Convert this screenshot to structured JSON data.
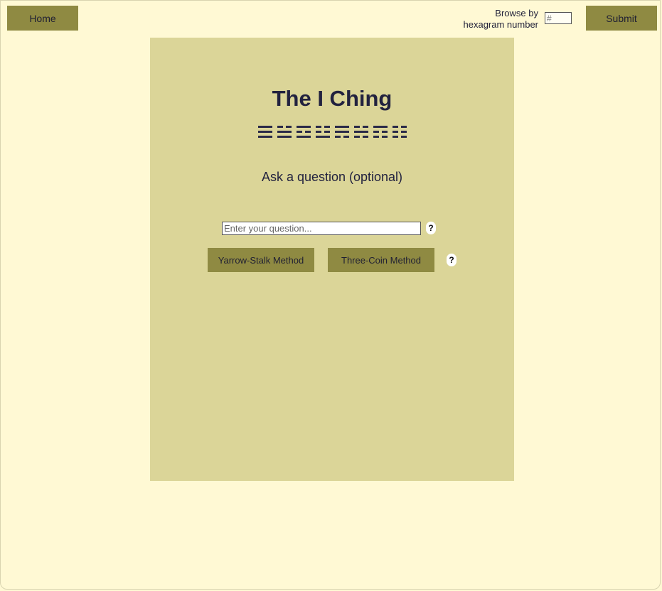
{
  "nav": {
    "home_label": "Home",
    "browse_label_line1": "Browse by",
    "browse_label_line2": "hexagram number",
    "hexagram_placeholder": "#",
    "submit_label": "Submit"
  },
  "main": {
    "title": "The I Ching",
    "trigrams": [
      {
        "name": "qian-heaven",
        "lines": [
          "solid",
          "solid",
          "solid"
        ]
      },
      {
        "name": "dui-lake",
        "lines": [
          "broken",
          "solid",
          "solid"
        ]
      },
      {
        "name": "li-fire",
        "lines": [
          "solid",
          "broken",
          "solid"
        ]
      },
      {
        "name": "zhen-thunder",
        "lines": [
          "broken",
          "broken",
          "solid"
        ]
      },
      {
        "name": "xun-wind",
        "lines": [
          "solid",
          "solid",
          "broken"
        ]
      },
      {
        "name": "kan-water",
        "lines": [
          "broken",
          "solid",
          "broken"
        ]
      },
      {
        "name": "gen-mountain",
        "lines": [
          "solid",
          "broken",
          "broken"
        ]
      },
      {
        "name": "kun-earth",
        "lines": [
          "broken",
          "broken",
          "broken"
        ]
      }
    ],
    "subtitle": "Ask a question (optional)",
    "question_placeholder": "Enter your question...",
    "question_value": "",
    "help_label": "?",
    "yarrow_label": "Yarrow-Stalk Method",
    "coin_label": "Three-Coin Method"
  },
  "colors": {
    "background": "#fff9d4",
    "panel": "#dbd598",
    "button": "#8f8a42",
    "text": "#22223f"
  }
}
